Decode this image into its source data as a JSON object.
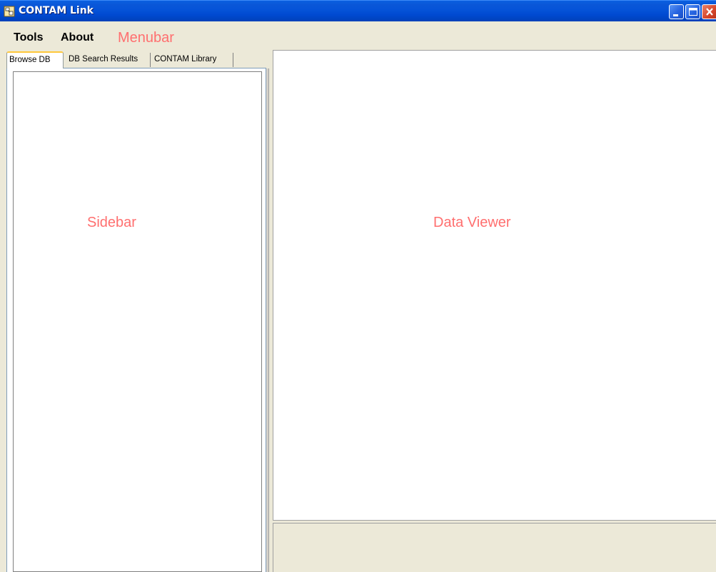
{
  "window": {
    "title": "CONTAM Link",
    "app_icon": "app-window-icon",
    "controls": {
      "minimize_icon": "minimize-icon",
      "maximize_icon": "maximize-icon",
      "close_icon": "close-icon"
    }
  },
  "menubar": {
    "items": [
      {
        "label": "Tools"
      },
      {
        "label": "About"
      }
    ],
    "annotation": "Menubar"
  },
  "sidebar": {
    "tabs": [
      {
        "label": "Browse DB",
        "active": true
      },
      {
        "label": "DB Search Results",
        "active": false
      },
      {
        "label": "CONTAM Library",
        "active": false
      }
    ],
    "annotation": "Sidebar"
  },
  "viewer": {
    "annotation": "Data Viewer"
  },
  "colors": {
    "titlebar": "#0553d8",
    "annotation": "#ff6f6f",
    "chrome": "#ece9d8",
    "active_tab_accent": "#ffc83c"
  }
}
